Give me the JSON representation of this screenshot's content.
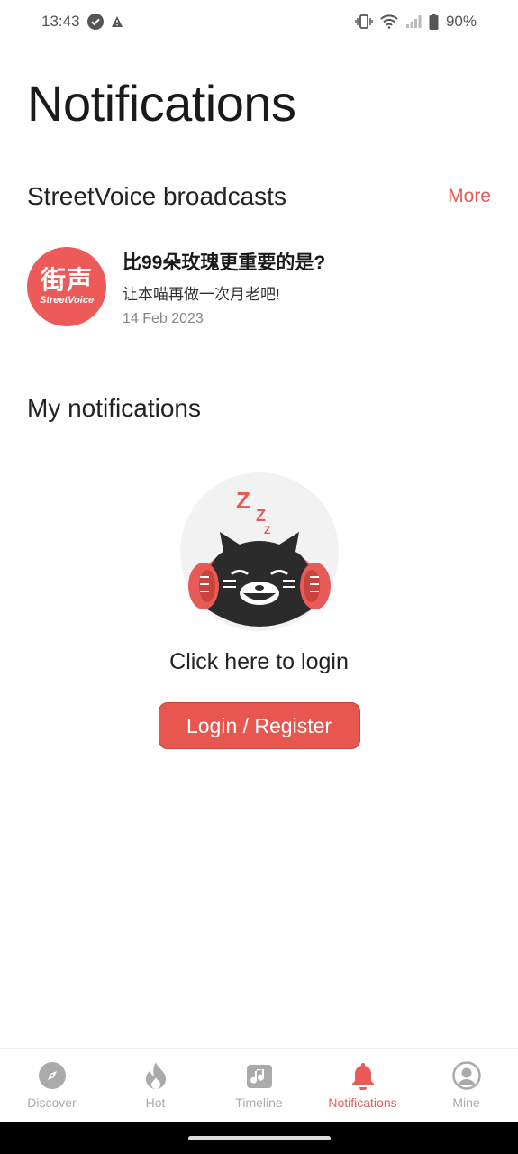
{
  "status_bar": {
    "time": "13:43",
    "battery": "90%",
    "icons": [
      "check-circle-icon",
      "alert-icon",
      "vibrate-icon",
      "wifi-icon",
      "signal-icon",
      "battery-icon"
    ]
  },
  "page": {
    "title": "Notifications"
  },
  "broadcasts": {
    "section_title": "StreetVoice broadcasts",
    "more_label": "More",
    "logo_text_cn": "街声",
    "logo_text_en": "StreetVoice",
    "item": {
      "title": "比99朵玫瑰更重要的是?",
      "subtitle": "让本喵再做一次月老吧!",
      "date": "14 Feb 2023"
    }
  },
  "my_notifications": {
    "section_title": "My notifications",
    "empty_prompt": "Click here to login",
    "login_button": "Login / Register",
    "mascot_icon": "sleeping-cat-headphones-icon"
  },
  "bottom_nav": {
    "items": [
      {
        "label": "Discover",
        "icon": "compass-icon"
      },
      {
        "label": "Hot",
        "icon": "flame-icon"
      },
      {
        "label": "Timeline",
        "icon": "music-note-icon"
      },
      {
        "label": "Notifications",
        "icon": "bell-icon"
      },
      {
        "label": "Mine",
        "icon": "user-icon"
      }
    ],
    "active_index": 3
  },
  "colors": {
    "accent": "#e85a55",
    "inactive": "#aaaaaa",
    "logo_bg": "#ec5a5a"
  }
}
